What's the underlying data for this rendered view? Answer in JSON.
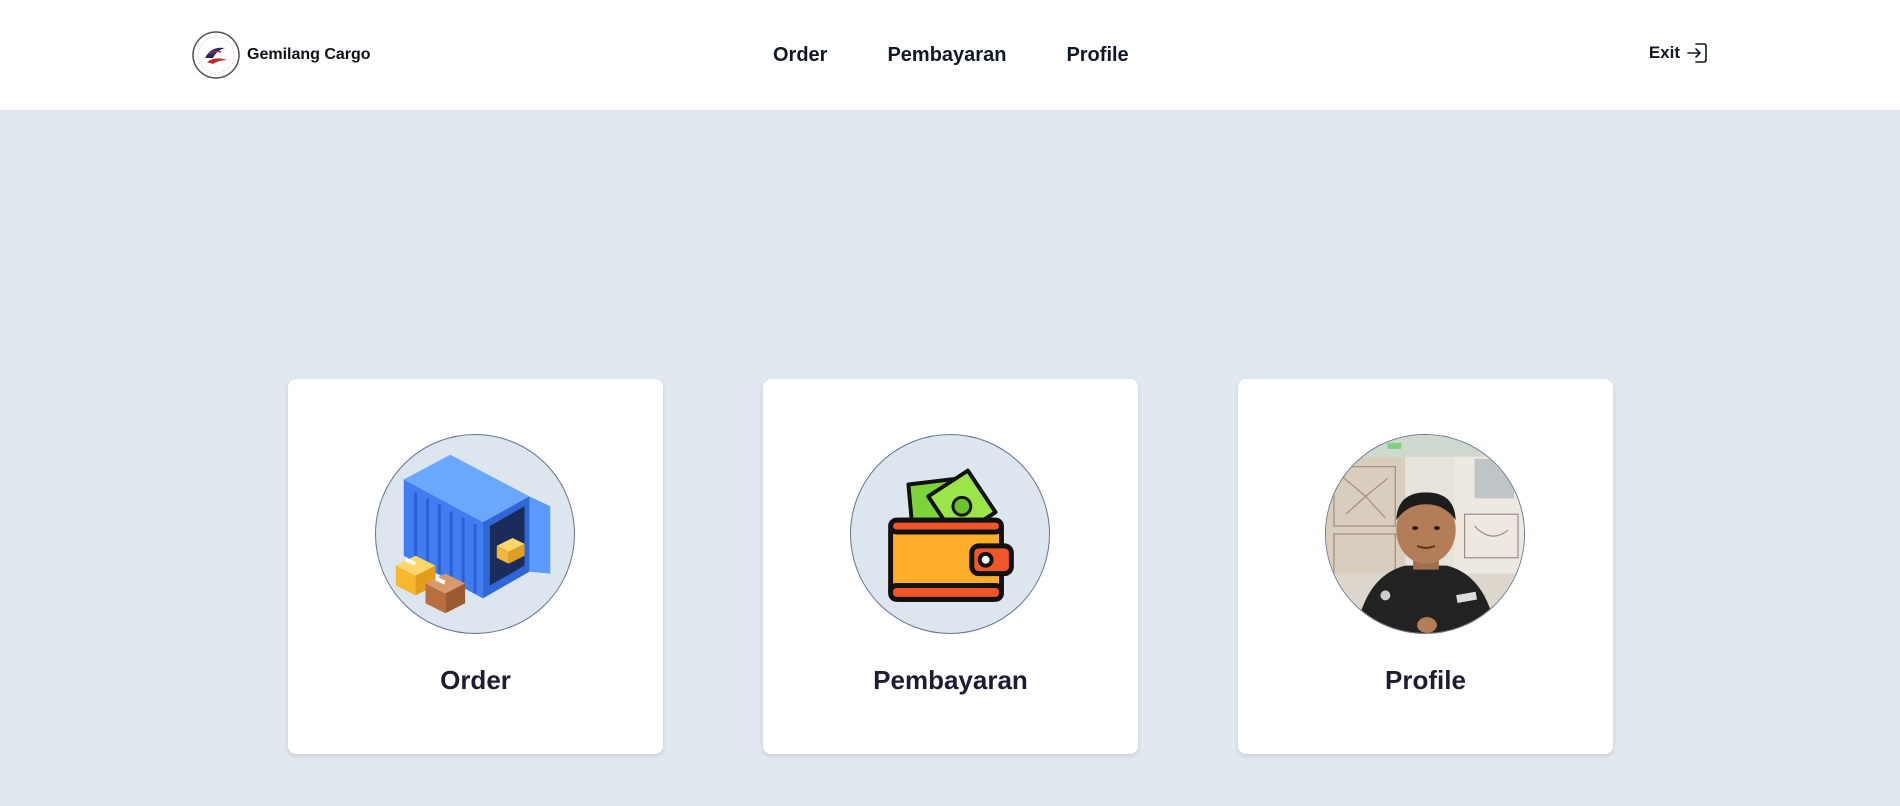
{
  "brand": {
    "name": "Gemilang Cargo",
    "logo_icon": "gemilang-cargo-logo"
  },
  "nav": {
    "items": [
      {
        "label": "Order"
      },
      {
        "label": "Pembayaran"
      },
      {
        "label": "Profile"
      }
    ],
    "exit_label": "Exit",
    "exit_icon": "sign-in-arrow-icon"
  },
  "cards": [
    {
      "label": "Order",
      "icon": "shipping-container-icon"
    },
    {
      "label": "Pembayaran",
      "icon": "wallet-money-icon"
    },
    {
      "label": "Profile",
      "icon": "user-profile-photo"
    }
  ],
  "colors": {
    "navbar_bg": "#ffffff",
    "page_bg": "#e2e8f0",
    "text": "#111827",
    "container_blue": "#4b8df8",
    "wallet_orange": "#f4a621",
    "money_green": "#8bd93f"
  }
}
